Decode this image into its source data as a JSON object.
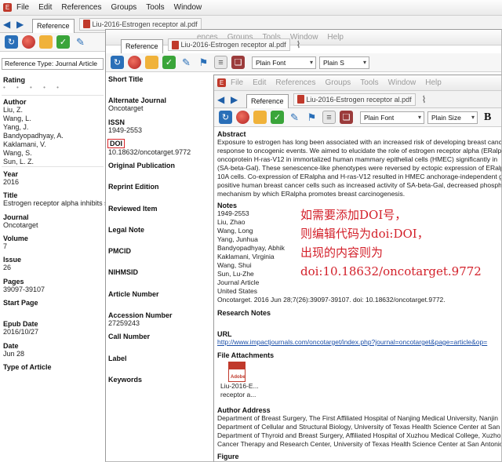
{
  "menu": {
    "items": [
      "File",
      "Edit",
      "References",
      "Groups",
      "Tools",
      "Window",
      "Help"
    ],
    "w2_visible": [
      "ences",
      "Groups",
      "Tools",
      "Window",
      "Help"
    ]
  },
  "tabs": {
    "reference_label": "Reference",
    "pdf_w1": "Liu-2016-Estrogen receptor al.pdf",
    "pdf_w2": "Liu-2016-Estrogen receptor al.pdf",
    "pdf_w3": "Liu-2016-Estrogen receptor al.pdf"
  },
  "toolbar": {
    "font_w2": "Plain Font",
    "size_w2": "Plain S",
    "font_w3": "Plain Font",
    "size_w3": "Plain Size",
    "bold": "B"
  },
  "w1": {
    "reference_type": "Reference Type:  Journal Article",
    "rating_label": "Rating",
    "rating_dots": "• • • • •",
    "author_label": "Author",
    "authors": [
      "Liu, Z.",
      "Wang, L.",
      "Yang, J.",
      "Bandyopadhyay, A.",
      "Kaklamani, V.",
      "Wang, S.",
      "Sun, L. Z."
    ],
    "year_label": "Year",
    "year": "2016",
    "title_label": "Title",
    "title": "Estrogen receptor alpha inhibits se",
    "journal_label": "Journal",
    "journal": "Oncotarget",
    "volume_label": "Volume",
    "volume": "7",
    "issue_label": "Issue",
    "issue": "26",
    "pages_label": "Pages",
    "pages": "39097-39107",
    "start_page_label": "Start Page",
    "epub_label": "Epub Date",
    "epub": "2016/10/27",
    "date_label": "Date",
    "date": "Jun 28",
    "type_label": "Type of Article"
  },
  "w2": {
    "short_title_label": "Short Title",
    "alt_journal_label": "Alternate Journal",
    "alt_journal": "Oncotarget",
    "issn_label": "ISSN",
    "issn": "1949-2553",
    "doi_label": "DOI",
    "doi": "10.18632/oncotarget.9772",
    "orig_pub_label": "Original Publication",
    "reprint_label": "Reprint Edition",
    "reviewed_label": "Reviewed Item",
    "legal_label": "Legal Note",
    "pmcid_label": "PMCID",
    "nihmsid_label": "NIHMSID",
    "article_no_label": "Article Number",
    "accession_label": "Accession Number",
    "accession": "27259243",
    "call_label": "Call Number",
    "label_label": "Label",
    "keywords_label": "Keywords"
  },
  "w3": {
    "abstract_label": "Abstract",
    "abstract_lines": [
      "Exposure to estrogen has long been associated with an increased risk of developing breast cance",
      "response to oncogenic events. We aimed to elucidate the role of estrogen receptor alpha (ERalp",
      "oncoprotein H-ras-V12 in immortalized human mammary epithelial cells (HMEC) significantly in",
      "(SA-beta-Gal). These senescence-like phenotypes were reversed by ectopic expression of ERalph",
      "10A cells. Co-expression of ERalpha and H-ras-V12 resulted in HMEC anchorage-independent gr",
      "positive human breast cancer cells such as increased activity of SA-beta-Gal, decreased phospho",
      "mechanism by which ERalpha promotes breast carcinogenesis."
    ],
    "notes_label": "Notes",
    "notes_lines": [
      "1949-2553",
      "Liu, Zhao",
      "Wang, Long",
      "Yang, Junhua",
      "Bandyopadhyay, Abhik",
      "Kaklamani, Virginia",
      "Wang, Shui",
      "Sun, Lu-Zhe",
      "Journal Article",
      "United States",
      "Oncotarget. 2016 Jun 28;7(26):39097-39107. doi: 10.18632/oncotarget.9772."
    ],
    "research_notes_label": "Research Notes",
    "url_label": "URL",
    "url": "http://www.impactjournals.com/oncotarget/index.php?journal=oncotarget&page=article&op=",
    "attachments_label": "File Attachments",
    "attachment_name_1": "Liu-2016-E...",
    "attachment_name_2": "receptor a...",
    "pdf_badge": "Adobe",
    "address_label": "Author Address",
    "address_lines": [
      "Department of Breast Surgery, The First Affiliated Hospital of Nanjing Medical University, Nanjin",
      "Department of Cellular and Structural Biology, University of Texas Health Science Center at San A",
      "Department of Thyroid and Breast Surgery, Affiliated Hospital of Xuzhou Medical College, Xuzho",
      "Cancer Therapy and Research Center, University of Texas Health Science Center at San Antonio,"
    ],
    "figure_label": "Figure"
  },
  "annotation": {
    "line1": "如需要添加DOI号，",
    "line2": "则编辑代码为doi:DOI，",
    "line3": "出现的内容则为",
    "line4": "doi:10.18632/oncotarget.9772"
  },
  "colors": {
    "annotation_red": "#d3202a",
    "link_blue": "#1a4ea8",
    "nav_blue": "#1f5fa8"
  }
}
